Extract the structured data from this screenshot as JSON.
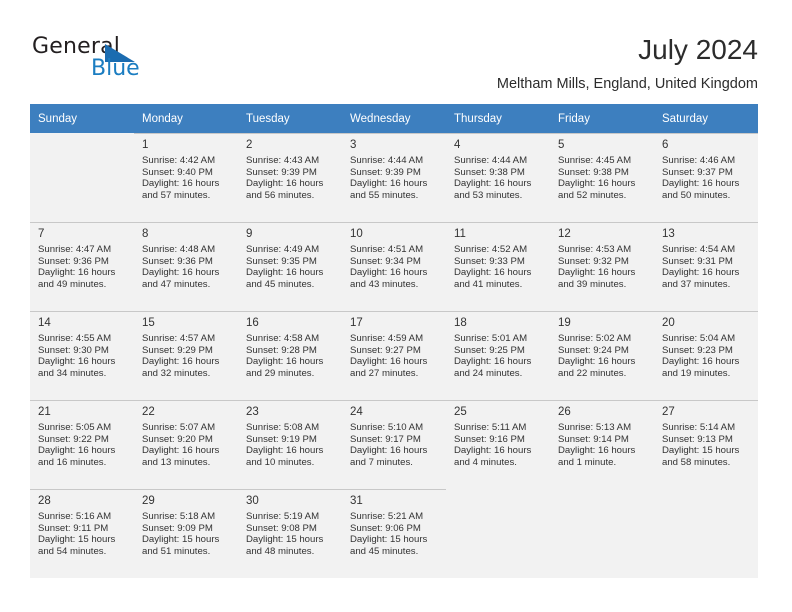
{
  "brand": {
    "name_part1": "General",
    "name_part2": "Blue",
    "logo_icon": "triangle-icon",
    "accent_color": "#1b6cb0"
  },
  "header": {
    "title": "July 2024",
    "subtitle": "Meltham Mills, England, United Kingdom"
  },
  "calendar": {
    "header_color": "#3d7fbf",
    "weekdays": [
      "Sunday",
      "Monday",
      "Tuesday",
      "Wednesday",
      "Thursday",
      "Friday",
      "Saturday"
    ],
    "weeks": [
      [
        {
          "day": "",
          "sunrise": "",
          "sunset": "",
          "daylight_line1": "",
          "daylight_line2": ""
        },
        {
          "day": "1",
          "sunrise": "Sunrise: 4:42 AM",
          "sunset": "Sunset: 9:40 PM",
          "daylight_line1": "Daylight: 16 hours",
          "daylight_line2": "and 57 minutes."
        },
        {
          "day": "2",
          "sunrise": "Sunrise: 4:43 AM",
          "sunset": "Sunset: 9:39 PM",
          "daylight_line1": "Daylight: 16 hours",
          "daylight_line2": "and 56 minutes."
        },
        {
          "day": "3",
          "sunrise": "Sunrise: 4:44 AM",
          "sunset": "Sunset: 9:39 PM",
          "daylight_line1": "Daylight: 16 hours",
          "daylight_line2": "and 55 minutes."
        },
        {
          "day": "4",
          "sunrise": "Sunrise: 4:44 AM",
          "sunset": "Sunset: 9:38 PM",
          "daylight_line1": "Daylight: 16 hours",
          "daylight_line2": "and 53 minutes."
        },
        {
          "day": "5",
          "sunrise": "Sunrise: 4:45 AM",
          "sunset": "Sunset: 9:38 PM",
          "daylight_line1": "Daylight: 16 hours",
          "daylight_line2": "and 52 minutes."
        },
        {
          "day": "6",
          "sunrise": "Sunrise: 4:46 AM",
          "sunset": "Sunset: 9:37 PM",
          "daylight_line1": "Daylight: 16 hours",
          "daylight_line2": "and 50 minutes."
        }
      ],
      [
        {
          "day": "7",
          "sunrise": "Sunrise: 4:47 AM",
          "sunset": "Sunset: 9:36 PM",
          "daylight_line1": "Daylight: 16 hours",
          "daylight_line2": "and 49 minutes."
        },
        {
          "day": "8",
          "sunrise": "Sunrise: 4:48 AM",
          "sunset": "Sunset: 9:36 PM",
          "daylight_line1": "Daylight: 16 hours",
          "daylight_line2": "and 47 minutes."
        },
        {
          "day": "9",
          "sunrise": "Sunrise: 4:49 AM",
          "sunset": "Sunset: 9:35 PM",
          "daylight_line1": "Daylight: 16 hours",
          "daylight_line2": "and 45 minutes."
        },
        {
          "day": "10",
          "sunrise": "Sunrise: 4:51 AM",
          "sunset": "Sunset: 9:34 PM",
          "daylight_line1": "Daylight: 16 hours",
          "daylight_line2": "and 43 minutes."
        },
        {
          "day": "11",
          "sunrise": "Sunrise: 4:52 AM",
          "sunset": "Sunset: 9:33 PM",
          "daylight_line1": "Daylight: 16 hours",
          "daylight_line2": "and 41 minutes."
        },
        {
          "day": "12",
          "sunrise": "Sunrise: 4:53 AM",
          "sunset": "Sunset: 9:32 PM",
          "daylight_line1": "Daylight: 16 hours",
          "daylight_line2": "and 39 minutes."
        },
        {
          "day": "13",
          "sunrise": "Sunrise: 4:54 AM",
          "sunset": "Sunset: 9:31 PM",
          "daylight_line1": "Daylight: 16 hours",
          "daylight_line2": "and 37 minutes."
        }
      ],
      [
        {
          "day": "14",
          "sunrise": "Sunrise: 4:55 AM",
          "sunset": "Sunset: 9:30 PM",
          "daylight_line1": "Daylight: 16 hours",
          "daylight_line2": "and 34 minutes."
        },
        {
          "day": "15",
          "sunrise": "Sunrise: 4:57 AM",
          "sunset": "Sunset: 9:29 PM",
          "daylight_line1": "Daylight: 16 hours",
          "daylight_line2": "and 32 minutes."
        },
        {
          "day": "16",
          "sunrise": "Sunrise: 4:58 AM",
          "sunset": "Sunset: 9:28 PM",
          "daylight_line1": "Daylight: 16 hours",
          "daylight_line2": "and 29 minutes."
        },
        {
          "day": "17",
          "sunrise": "Sunrise: 4:59 AM",
          "sunset": "Sunset: 9:27 PM",
          "daylight_line1": "Daylight: 16 hours",
          "daylight_line2": "and 27 minutes."
        },
        {
          "day": "18",
          "sunrise": "Sunrise: 5:01 AM",
          "sunset": "Sunset: 9:25 PM",
          "daylight_line1": "Daylight: 16 hours",
          "daylight_line2": "and 24 minutes."
        },
        {
          "day": "19",
          "sunrise": "Sunrise: 5:02 AM",
          "sunset": "Sunset: 9:24 PM",
          "daylight_line1": "Daylight: 16 hours",
          "daylight_line2": "and 22 minutes."
        },
        {
          "day": "20",
          "sunrise": "Sunrise: 5:04 AM",
          "sunset": "Sunset: 9:23 PM",
          "daylight_line1": "Daylight: 16 hours",
          "daylight_line2": "and 19 minutes."
        }
      ],
      [
        {
          "day": "21",
          "sunrise": "Sunrise: 5:05 AM",
          "sunset": "Sunset: 9:22 PM",
          "daylight_line1": "Daylight: 16 hours",
          "daylight_line2": "and 16 minutes."
        },
        {
          "day": "22",
          "sunrise": "Sunrise: 5:07 AM",
          "sunset": "Sunset: 9:20 PM",
          "daylight_line1": "Daylight: 16 hours",
          "daylight_line2": "and 13 minutes."
        },
        {
          "day": "23",
          "sunrise": "Sunrise: 5:08 AM",
          "sunset": "Sunset: 9:19 PM",
          "daylight_line1": "Daylight: 16 hours",
          "daylight_line2": "and 10 minutes."
        },
        {
          "day": "24",
          "sunrise": "Sunrise: 5:10 AM",
          "sunset": "Sunset: 9:17 PM",
          "daylight_line1": "Daylight: 16 hours",
          "daylight_line2": "and 7 minutes."
        },
        {
          "day": "25",
          "sunrise": "Sunrise: 5:11 AM",
          "sunset": "Sunset: 9:16 PM",
          "daylight_line1": "Daylight: 16 hours",
          "daylight_line2": "and 4 minutes."
        },
        {
          "day": "26",
          "sunrise": "Sunrise: 5:13 AM",
          "sunset": "Sunset: 9:14 PM",
          "daylight_line1": "Daylight: 16 hours",
          "daylight_line2": "and 1 minute."
        },
        {
          "day": "27",
          "sunrise": "Sunrise: 5:14 AM",
          "sunset": "Sunset: 9:13 PM",
          "daylight_line1": "Daylight: 15 hours",
          "daylight_line2": "and 58 minutes."
        }
      ],
      [
        {
          "day": "28",
          "sunrise": "Sunrise: 5:16 AM",
          "sunset": "Sunset: 9:11 PM",
          "daylight_line1": "Daylight: 15 hours",
          "daylight_line2": "and 54 minutes."
        },
        {
          "day": "29",
          "sunrise": "Sunrise: 5:18 AM",
          "sunset": "Sunset: 9:09 PM",
          "daylight_line1": "Daylight: 15 hours",
          "daylight_line2": "and 51 minutes."
        },
        {
          "day": "30",
          "sunrise": "Sunrise: 5:19 AM",
          "sunset": "Sunset: 9:08 PM",
          "daylight_line1": "Daylight: 15 hours",
          "daylight_line2": "and 48 minutes."
        },
        {
          "day": "31",
          "sunrise": "Sunrise: 5:21 AM",
          "sunset": "Sunset: 9:06 PM",
          "daylight_line1": "Daylight: 15 hours",
          "daylight_line2": "and 45 minutes."
        },
        {
          "day": "",
          "sunrise": "",
          "sunset": "",
          "daylight_line1": "",
          "daylight_line2": ""
        },
        {
          "day": "",
          "sunrise": "",
          "sunset": "",
          "daylight_line1": "",
          "daylight_line2": ""
        },
        {
          "day": "",
          "sunrise": "",
          "sunset": "",
          "daylight_line1": "",
          "daylight_line2": ""
        }
      ]
    ]
  }
}
